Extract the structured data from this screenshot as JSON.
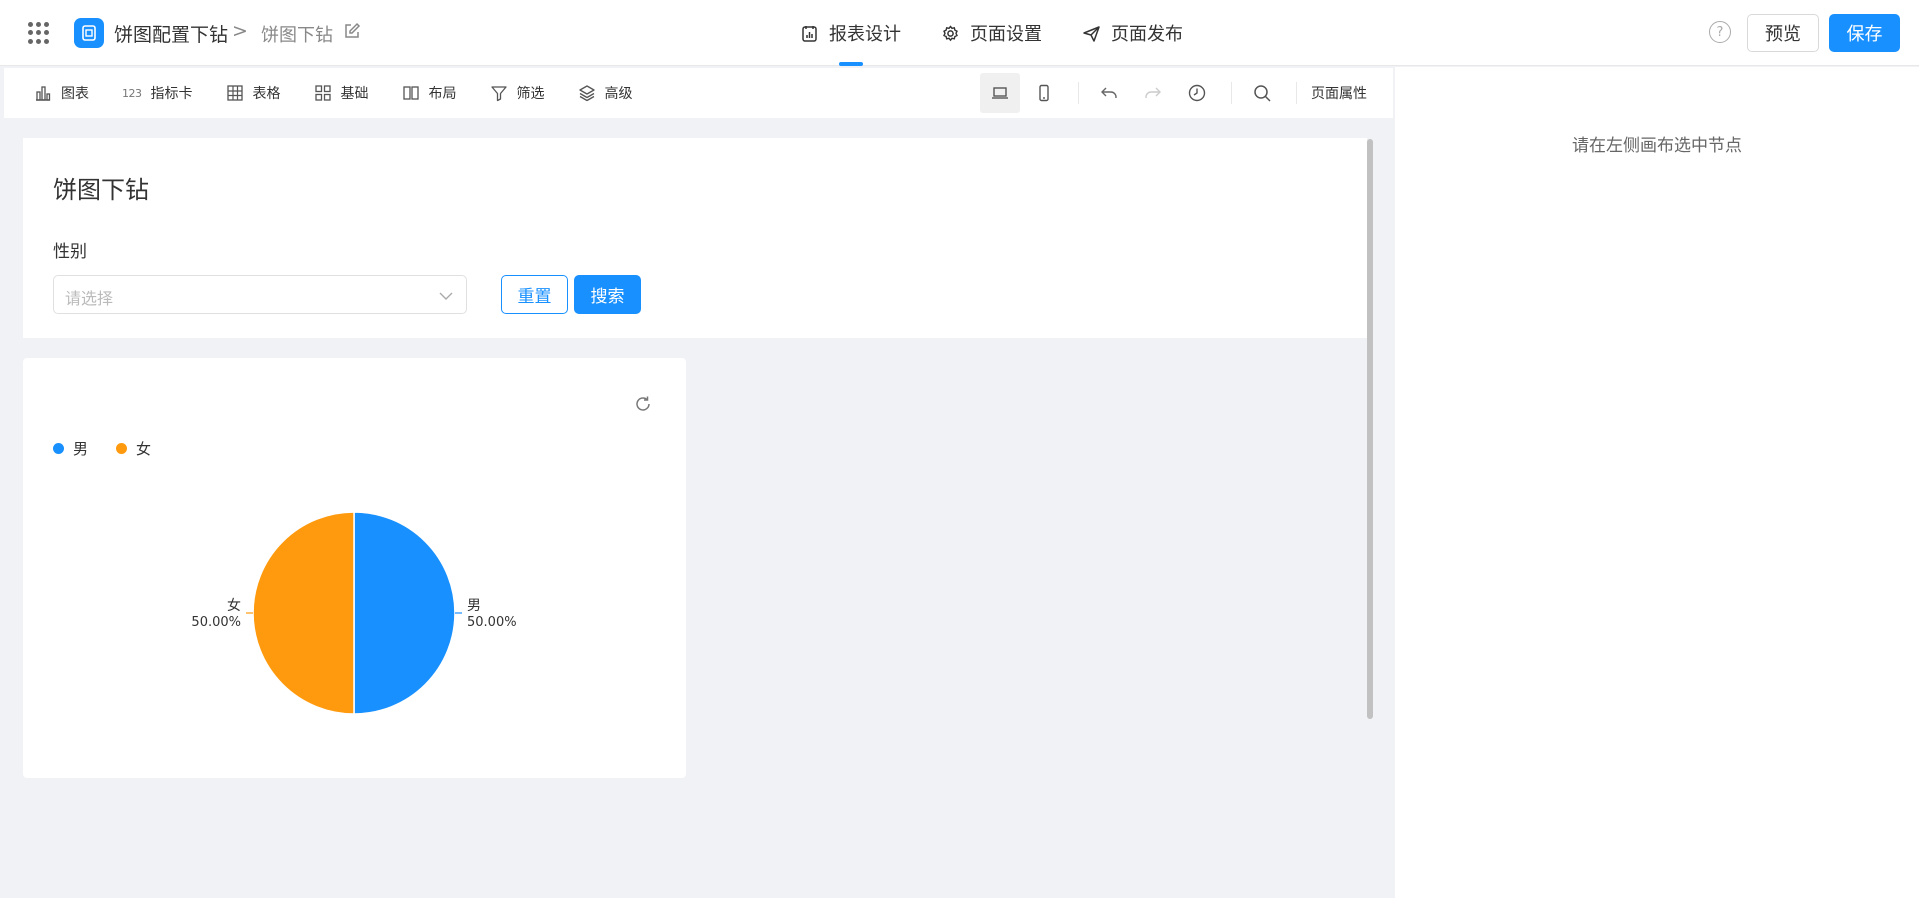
{
  "header": {
    "app_name": "饼图配置下钻",
    "crumb_separator": ">",
    "page_name": "饼图下钻",
    "tabs": [
      {
        "label": "报表设计",
        "icon": "report-design-icon",
        "active": true
      },
      {
        "label": "页面设置",
        "icon": "gear-icon",
        "active": false
      },
      {
        "label": "页面发布",
        "icon": "send-icon",
        "active": false
      }
    ],
    "help": "?",
    "preview_label": "预览",
    "save_label": "保存",
    "accent_color": "#1890ff"
  },
  "toolbar": {
    "items": [
      {
        "label": "图表",
        "icon": "bar-chart-icon"
      },
      {
        "label": "指标卡",
        "icon": "number-card-icon",
        "icon_text": "123"
      },
      {
        "label": "表格",
        "icon": "table-icon"
      },
      {
        "label": "基础",
        "icon": "grid-icon"
      },
      {
        "label": "布局",
        "icon": "layout-icon"
      },
      {
        "label": "筛选",
        "icon": "filter-icon"
      },
      {
        "label": "高级",
        "icon": "layers-icon"
      }
    ],
    "page_props_label": "页面属性"
  },
  "right_panel": {
    "hint": "请在左侧画布选中节点"
  },
  "filter": {
    "title": "饼图下钻",
    "label": "性别",
    "placeholder": "请选择",
    "reset_label": "重置",
    "search_label": "搜索"
  },
  "chart_data": {
    "type": "pie",
    "title": "",
    "categories": [
      "男",
      "女"
    ],
    "values": [
      50,
      50
    ],
    "value_labels": [
      "50.00%",
      "50.00%"
    ],
    "colors": [
      "#1890ff",
      "#ff9a0e"
    ],
    "legend": "top-left"
  }
}
